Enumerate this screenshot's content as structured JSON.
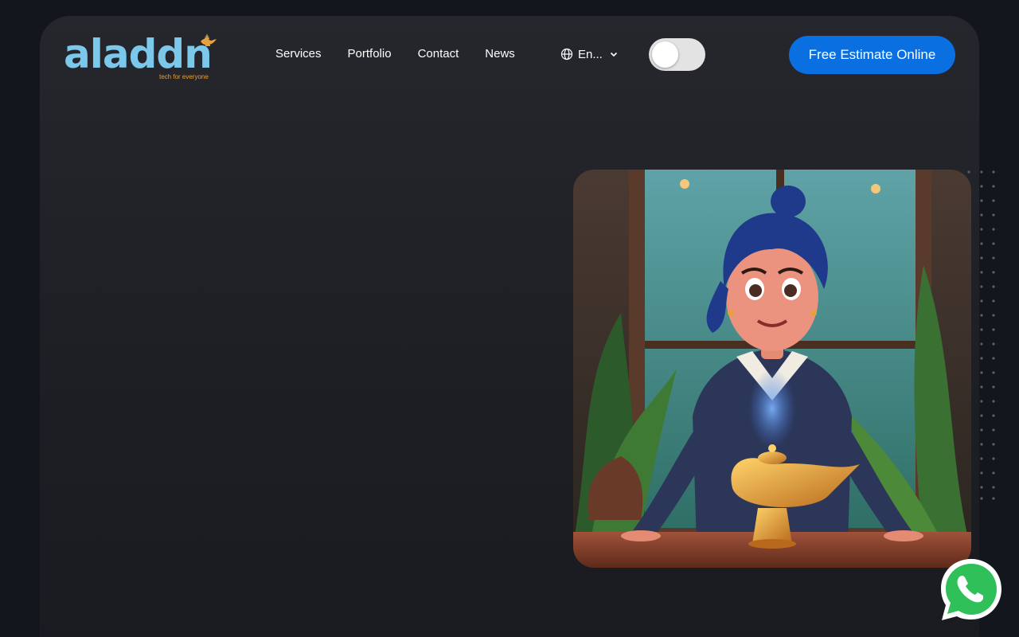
{
  "logo": {
    "wordmark": "aladdn",
    "tagline": "tech for everyone"
  },
  "nav": {
    "items": [
      "Services",
      "Portfolio",
      "Contact",
      "News"
    ]
  },
  "language": {
    "selected": "En..."
  },
  "theme_toggle": {
    "state": "off"
  },
  "cta": {
    "label": "Free Estimate Online"
  },
  "icons": {
    "language": "globe-icon",
    "dropdown": "chevron-down-icon",
    "chat": "whatsapp-icon"
  },
  "colors": {
    "accent": "#0a6fe0",
    "logo": "#7cc8ea",
    "tagline": "#e6a13a",
    "background": "#14161d",
    "whatsapp": "#2fc05a"
  }
}
